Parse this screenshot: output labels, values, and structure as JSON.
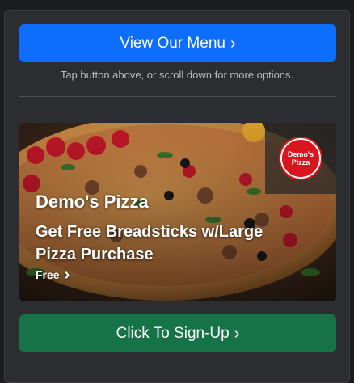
{
  "menu_button": {
    "label": "View Our Menu",
    "icon": "chevron-right-icon"
  },
  "hint": "Tap button above, or scroll down for more options.",
  "promo": {
    "logo_line1": "Demo's",
    "logo_line2": "Pizza",
    "title": "Demo's Pizza",
    "offer": "Get Free Breadsticks w/Large Pizza Purchase",
    "tag": "Free"
  },
  "signup_button": {
    "label": "Click To Sign-Up",
    "icon": "chevron-right-icon"
  },
  "colors": {
    "primary": "#0d6efd",
    "success": "#157347",
    "logo_red": "#d9141d",
    "panel": "#2b2d31"
  }
}
